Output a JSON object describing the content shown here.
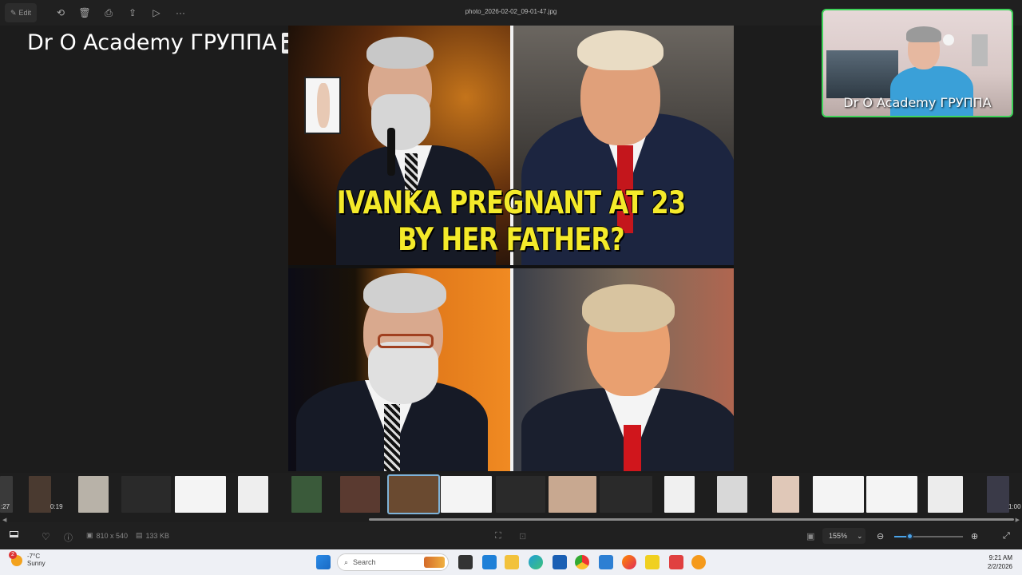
{
  "toolbar": {
    "edit_label": "Edit",
    "file_name": "photo_2026-02-02_09-01-47.jpg"
  },
  "overlay": {
    "title": "Dr O Academy ГРУППА"
  },
  "photo": {
    "headline_line1": "IVANKA PREGNANT AT 23",
    "headline_line2": "BY HER FATHER?"
  },
  "webcam": {
    "name": "Dr O Academy ГРУППА"
  },
  "filmstrip": {
    "time_left": ":27",
    "time_mid": "0:19",
    "time_right": "1:00"
  },
  "statusbar": {
    "dimensions": "810 x 540",
    "file_size": "133 KB",
    "zoom": "155%"
  },
  "taskbar": {
    "weather_temp": "-7°C",
    "weather_cond": "Sunny",
    "weather_badge": "2",
    "search_placeholder": "Search",
    "time": "9:21 AM",
    "date": "2/2/2026"
  },
  "colors": {
    "headline": "#f4ea2a",
    "webcam_border": "#3fd35a",
    "accent": "#4aa3e8"
  }
}
